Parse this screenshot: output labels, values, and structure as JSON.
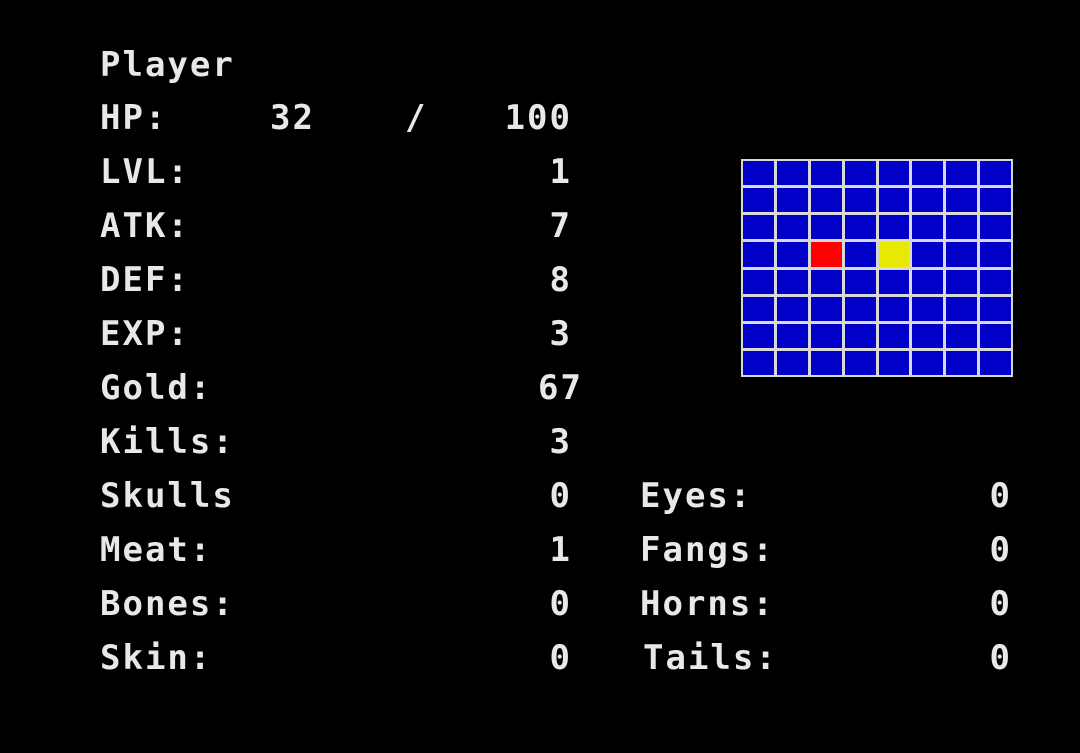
{
  "player": {
    "title": "Player",
    "hp_label": "HP:",
    "hp_current": "32",
    "hp_separator": "/",
    "hp_max": "100"
  },
  "stats": [
    {
      "label": "LVL:",
      "value": "1"
    },
    {
      "label": "ATK:",
      "value": "7"
    },
    {
      "label": "DEF:",
      "value": "8"
    },
    {
      "label": "EXP:",
      "value": "3"
    },
    {
      "label": "Gold:",
      "value": "67"
    },
    {
      "label": "Kills:",
      "value": "3"
    }
  ],
  "inventory_left": [
    {
      "label": "Skulls",
      "value": "0"
    },
    {
      "label": "Meat:",
      "value": "1"
    },
    {
      "label": "Bones:",
      "value": "0"
    },
    {
      "label": "Skin:",
      "value": "0"
    }
  ],
  "inventory_right": [
    {
      "label": "Eyes:",
      "value": "0"
    },
    {
      "label": "Fangs:",
      "value": "0"
    },
    {
      "label": "Horns:",
      "value": "0"
    },
    {
      "label": "Tails:",
      "value": "0"
    }
  ],
  "minimap": {
    "rows": 8,
    "cols": 8,
    "cell_color": "#0000c8",
    "grid_line_color": "#d8d8d8",
    "markers": [
      {
        "row": 3,
        "col": 2,
        "color": "#ff0000",
        "name": "player-marker"
      },
      {
        "row": 3,
        "col": 4,
        "color": "#e8e800",
        "name": "target-marker"
      }
    ]
  },
  "colors": {
    "background": "#000000",
    "text": "#e8e8e8"
  }
}
